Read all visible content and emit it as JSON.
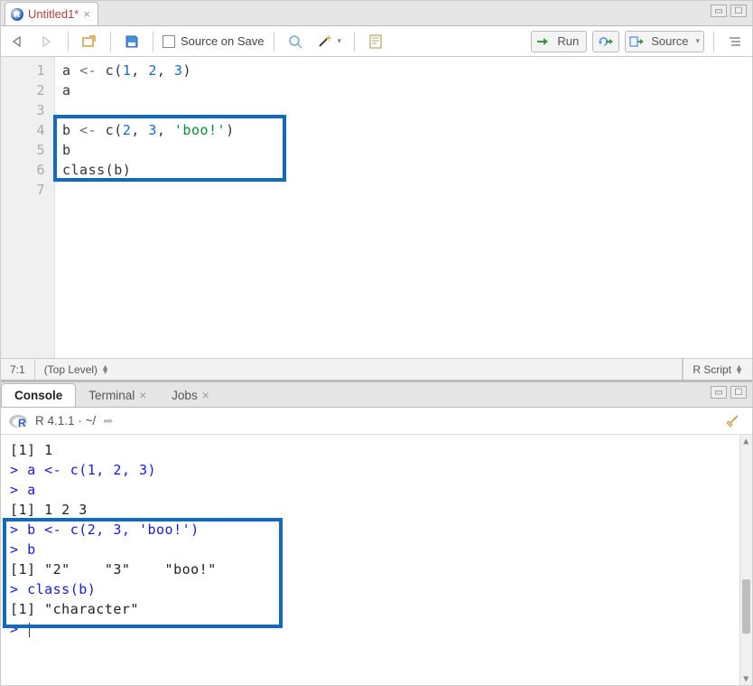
{
  "tab": {
    "title": "Untitled1*"
  },
  "toolbar": {
    "source_on_save": "Source on Save",
    "run": "Run",
    "source": "Source"
  },
  "editor": {
    "line_numbers": [
      "1",
      "2",
      "3",
      "4",
      "5",
      "6",
      "7"
    ],
    "lines": {
      "l1_a": "a ",
      "l1_op": "<- ",
      "l1_fn": "c",
      "l1_p1": "(",
      "l1_n1": "1",
      "l1_c1": ", ",
      "l1_n2": "2",
      "l1_c2": ", ",
      "l1_n3": "3",
      "l1_p2": ")",
      "l2": "a",
      "l4_a": "b ",
      "l4_op": "<- ",
      "l4_fn": "c",
      "l4_p1": "(",
      "l4_n1": "2",
      "l4_c1": ", ",
      "l4_n2": "3",
      "l4_c2": ", ",
      "l4_s": "'boo!'",
      "l4_p2": ")",
      "l5": "b",
      "l6_fn": "class",
      "l6_p1": "(",
      "l6_arg": "b",
      "l6_p2": ")"
    }
  },
  "statusbar": {
    "pos": "7:1",
    "scope": "(Top Level)",
    "lang": "R Script"
  },
  "console_tabs": {
    "console": "Console",
    "terminal": "Terminal",
    "jobs": "Jobs"
  },
  "console_info": {
    "version": "R 4.1.1",
    "path": " · ~/"
  },
  "console": {
    "o1": "[1] 1",
    "p": "> ",
    "i2": "a <- c(1, 2, 3)",
    "i3": "a",
    "o4": "[1] 1 2 3",
    "i5": "b <- c(2, 3, 'boo!')",
    "i6": "b",
    "o7": "[1] \"2\"    \"3\"    \"boo!\"",
    "i8": "class(b)",
    "o9": "[1] \"character\""
  }
}
